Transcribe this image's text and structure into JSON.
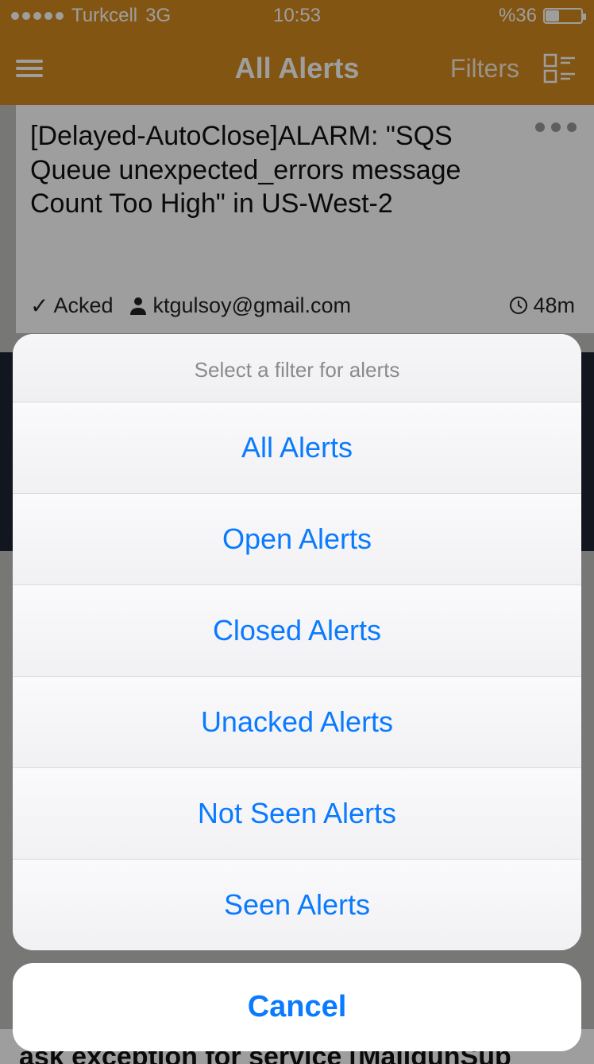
{
  "statusbar": {
    "carrier": "Turkcell",
    "network": "3G",
    "time": "10:53",
    "battery_pct": "%36"
  },
  "navbar": {
    "title": "All Alerts",
    "filters_label": "Filters"
  },
  "alert": {
    "title": "[Delayed-AutoClose]ALARM: \"SQS Queue unexpected_errors messageCount Too High\" in US-West-2",
    "ack_label": "Acked",
    "user": "ktgulsoy@gmail.com",
    "age": "48m"
  },
  "partial_text": "ask exception for service [MailgunSup",
  "sheet": {
    "header": "Select a filter for alerts",
    "options": [
      "All Alerts",
      "Open Alerts",
      "Closed Alerts",
      "Unacked Alerts",
      "Not Seen Alerts",
      "Seen Alerts"
    ],
    "cancel": "Cancel"
  }
}
